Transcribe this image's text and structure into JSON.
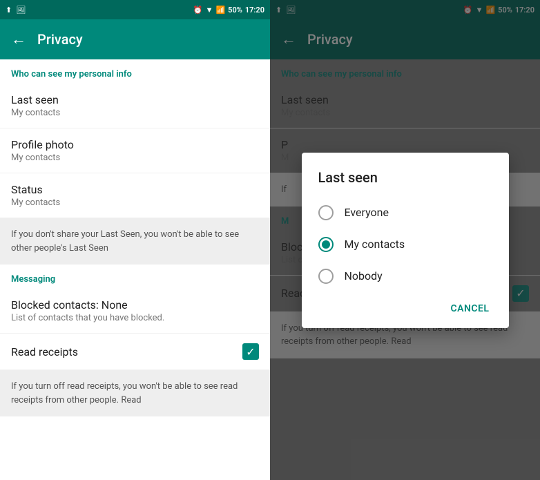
{
  "statusBar": {
    "timeLeft": "17:20",
    "timeRight": "17:20",
    "battery": "50%"
  },
  "header": {
    "backLabel": "←",
    "title": "Privacy"
  },
  "sections": {
    "personalInfo": {
      "header": "Who can see my personal info",
      "items": [
        {
          "label": "Last seen",
          "value": "My contacts"
        },
        {
          "label": "Profile photo",
          "value": "My contacts"
        },
        {
          "label": "Status",
          "value": "My contacts"
        }
      ],
      "note": "If you don't share your Last Seen, you won't be able to see other people's Last Seen"
    },
    "messaging": {
      "header": "Messaging",
      "items": [
        {
          "label": "Blocked contacts: None",
          "value": "List of contacts that you have blocked."
        }
      ],
      "readReceipts": {
        "label": "Read receipts",
        "checked": true
      },
      "readReceiptsNote": "If you turn off read receipts, you won't be able to see read receipts from other people. Read"
    }
  },
  "modal": {
    "title": "Last seen",
    "options": [
      {
        "label": "Everyone",
        "selected": false
      },
      {
        "label": "My contacts",
        "selected": true
      },
      {
        "label": "Nobody",
        "selected": false
      }
    ],
    "cancelLabel": "CANCEL"
  }
}
